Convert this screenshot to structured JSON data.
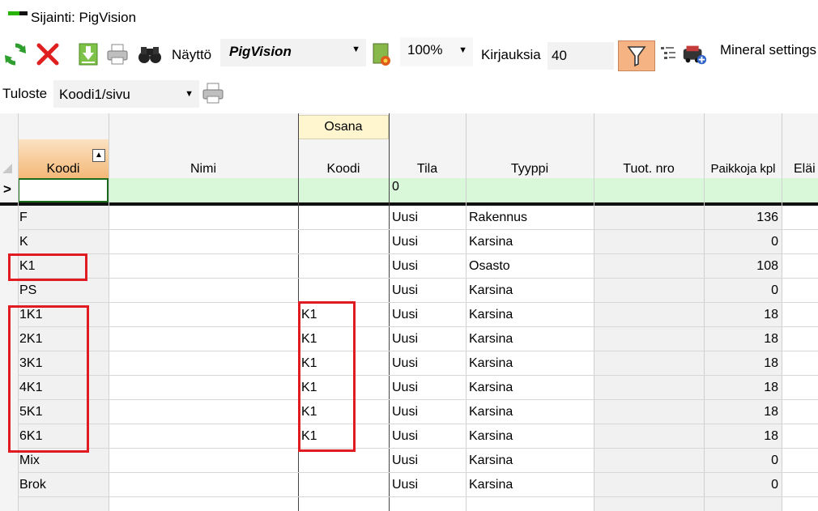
{
  "window": {
    "title": "Sijainti: PigVision"
  },
  "toolbar": {
    "view_label": "Näyttö",
    "view_value": "PigVision",
    "zoom_value": "100%",
    "records_label": "Kirjauksia",
    "records_value": "40",
    "mineral_settings_label": "Mineral settings"
  },
  "toolbar2": {
    "print_label": "Tuloste",
    "print_value": "Koodi1/sivu"
  },
  "grid": {
    "group_header": "Osana",
    "columns": [
      "Koodi",
      "Nimi",
      "Koodi",
      "Tila",
      "Tyyppi",
      "Tuot. nro",
      "Paikkoja kpl",
      "Eläi"
    ],
    "new_row_indicator": ">",
    "new_row_tila": "0",
    "rows": [
      {
        "koodi": "F",
        "nimi": "",
        "osana_koodi": "",
        "tila": "Uusi",
        "tyyppi": "Rakennus",
        "tuot_nro": "",
        "paikkoja": "136"
      },
      {
        "koodi": "K",
        "nimi": "",
        "osana_koodi": "",
        "tila": "Uusi",
        "tyyppi": "Karsina",
        "tuot_nro": "",
        "paikkoja": "0"
      },
      {
        "koodi": "K1",
        "nimi": "",
        "osana_koodi": "",
        "tila": "Uusi",
        "tyyppi": "Osasto",
        "tuot_nro": "",
        "paikkoja": "108"
      },
      {
        "koodi": "PS",
        "nimi": "",
        "osana_koodi": "",
        "tila": "Uusi",
        "tyyppi": "Karsina",
        "tuot_nro": "",
        "paikkoja": "0"
      },
      {
        "koodi": "1K1",
        "nimi": "",
        "osana_koodi": "K1",
        "tila": "Uusi",
        "tyyppi": "Karsina",
        "tuot_nro": "",
        "paikkoja": "18"
      },
      {
        "koodi": "2K1",
        "nimi": "",
        "osana_koodi": "K1",
        "tila": "Uusi",
        "tyyppi": "Karsina",
        "tuot_nro": "",
        "paikkoja": "18"
      },
      {
        "koodi": "3K1",
        "nimi": "",
        "osana_koodi": "K1",
        "tila": "Uusi",
        "tyyppi": "Karsina",
        "tuot_nro": "",
        "paikkoja": "18"
      },
      {
        "koodi": "4K1",
        "nimi": "",
        "osana_koodi": "K1",
        "tila": "Uusi",
        "tyyppi": "Karsina",
        "tuot_nro": "",
        "paikkoja": "18"
      },
      {
        "koodi": "5K1",
        "nimi": "",
        "osana_koodi": "K1",
        "tila": "Uusi",
        "tyyppi": "Karsina",
        "tuot_nro": "",
        "paikkoja": "18"
      },
      {
        "koodi": "6K1",
        "nimi": "",
        "osana_koodi": "K1",
        "tila": "Uusi",
        "tyyppi": "Karsina",
        "tuot_nro": "",
        "paikkoja": "18"
      },
      {
        "koodi": "Mix",
        "nimi": "",
        "osana_koodi": "",
        "tila": "Uusi",
        "tyyppi": "Karsina",
        "tuot_nro": "",
        "paikkoja": "0"
      },
      {
        "koodi": "Brok",
        "nimi": "",
        "osana_koodi": "",
        "tila": "Uusi",
        "tyyppi": "Karsina",
        "tuot_nro": "",
        "paikkoja": "0"
      }
    ]
  },
  "colors": {
    "sort_header_bg": "#f8cfa0",
    "new_row_bg": "#d9f7d9",
    "annotation_red": "#e11b22",
    "filter_active_bg": "#f5b383",
    "group_header_bg": "#fff6cf"
  }
}
